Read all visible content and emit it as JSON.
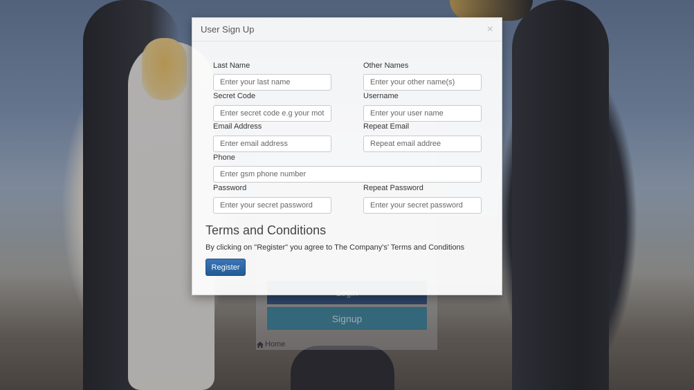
{
  "background": {
    "login_button_label": "Login",
    "signup_button_label": "Signup",
    "home_link_label": "Home",
    "home_icon": "home-icon"
  },
  "modal": {
    "title": "User Sign Up",
    "close_icon": "×",
    "fields": {
      "last_name": {
        "label": "Last Name",
        "placeholder": "Enter your last name"
      },
      "other_names": {
        "label": "Other Names",
        "placeholder": "Enter your other name(s)"
      },
      "secret_code": {
        "label": "Secret Code",
        "placeholder": "Enter secret code e.g your mother's maiden name"
      },
      "username": {
        "label": "Username",
        "placeholder": "Enter your user name"
      },
      "email": {
        "label": "Email Address",
        "placeholder": "Enter email address"
      },
      "repeat_email": {
        "label": "Repeat Email",
        "placeholder": "Repeat email addree"
      },
      "phone": {
        "label": "Phone",
        "placeholder": "Enter gsm phone number"
      },
      "password": {
        "label": "Password",
        "placeholder": "Enter your secret password"
      },
      "repeat_password": {
        "label": "Repeat Password",
        "placeholder": "Enter your secret password"
      }
    },
    "terms_title": "Terms and Conditions",
    "terms_text": "By clicking on \"Register\" you agree to The Company's' Terms and Conditions",
    "register_label": "Register"
  },
  "colors": {
    "register_button": "#2f6aa8",
    "login_button": "#244a78",
    "signup_button": "#2e7f96"
  }
}
